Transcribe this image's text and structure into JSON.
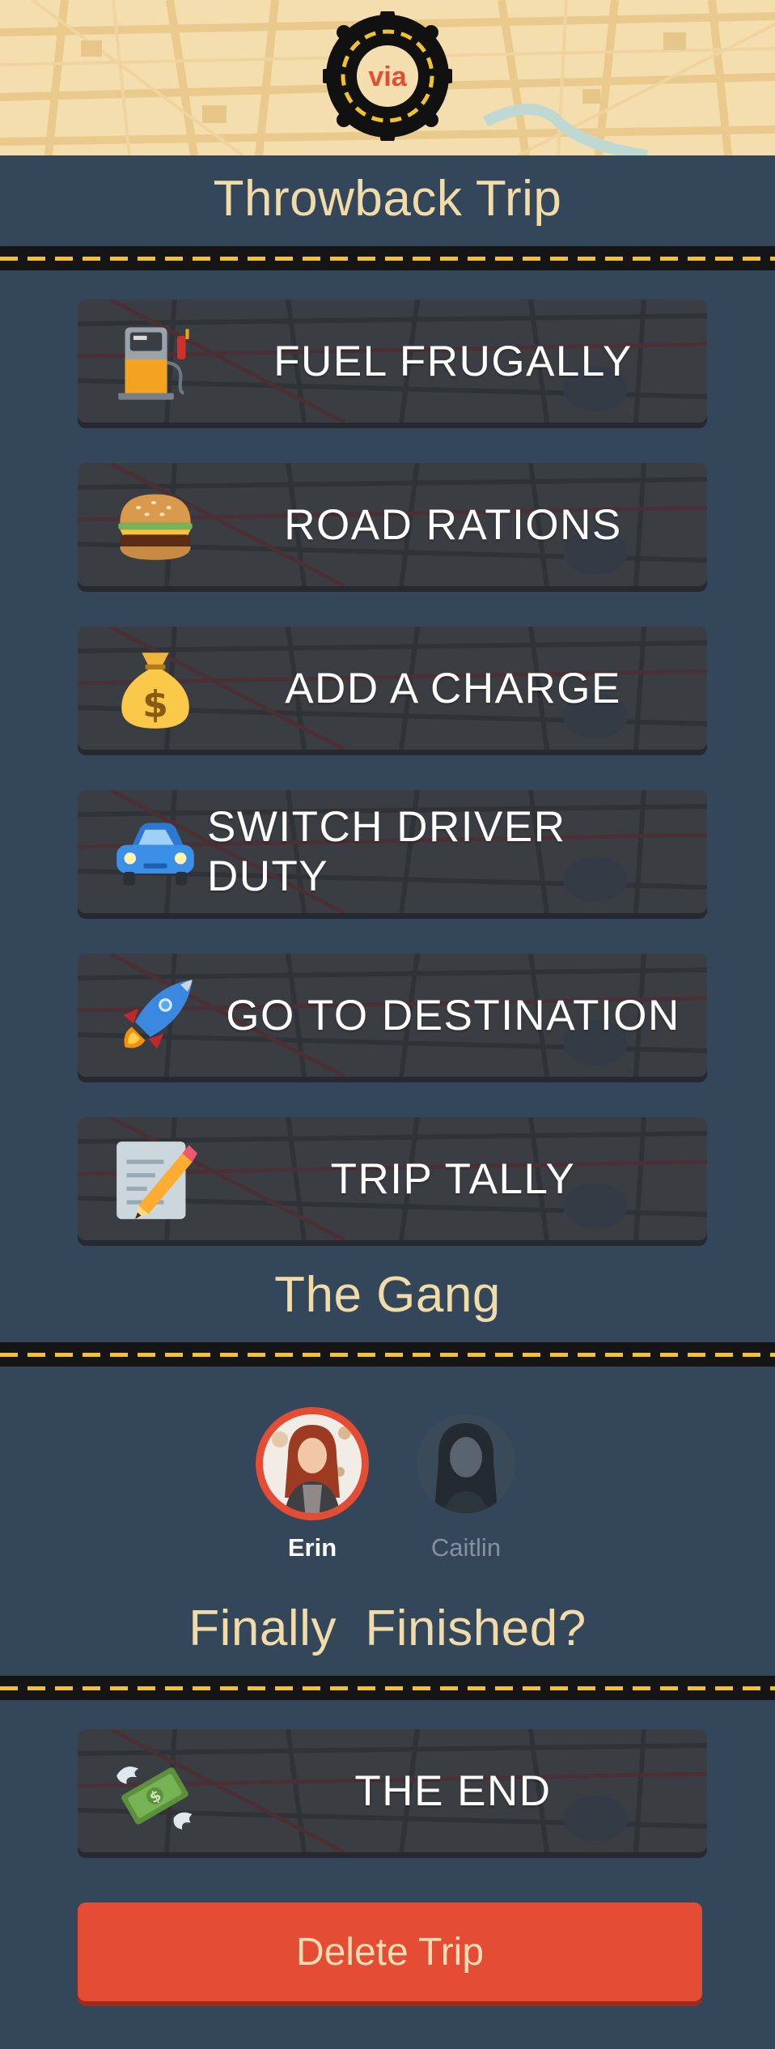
{
  "app": {
    "logo_text": "via"
  },
  "trip": {
    "title": "Throwback Trip"
  },
  "actions": [
    {
      "label": "FUEL FRUGALLY",
      "icon": "fuel-pump-icon"
    },
    {
      "label": "ROAD RATIONS",
      "icon": "hamburger-icon"
    },
    {
      "label": "ADD A CHARGE",
      "icon": "money-bag-icon"
    },
    {
      "label": "SWITCH DRIVER DUTY",
      "icon": "car-icon"
    },
    {
      "label": "GO TO DESTINATION",
      "icon": "rocket-icon"
    },
    {
      "label": "TRIP TALLY",
      "icon": "memo-pencil-icon"
    }
  ],
  "gang": {
    "title": "The Gang",
    "members": [
      {
        "name": "Erin",
        "active": true
      },
      {
        "name": "Caitlin",
        "active": false
      }
    ]
  },
  "finish": {
    "title": "Finally  Finished?",
    "end_action": {
      "label": "THE END",
      "icon": "money-with-wings-icon"
    },
    "delete_label": "Delete Trip"
  },
  "colors": {
    "background": "#34475a",
    "title_cream": "#f1dca9",
    "road_stripe": "#f2c230",
    "tile": "#3a3d42",
    "delete": "#e44c33",
    "active_ring": "#e44c33"
  }
}
